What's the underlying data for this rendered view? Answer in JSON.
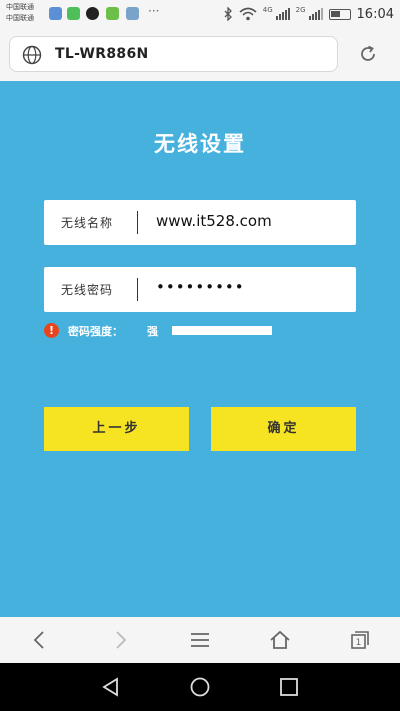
{
  "status_bar": {
    "carrier_line1": "中国联通",
    "carrier_line2": "中国联通",
    "net_4g": "4G",
    "net_2g": "2G",
    "time": "16:04"
  },
  "address_bar": {
    "url": "TL-WR886N"
  },
  "page": {
    "title": "无线设置",
    "ssid_label": "无线名称",
    "ssid_value": "www.it528.com",
    "password_label": "无线密码",
    "password_value": "•••••••••",
    "strength_label": "密码强度：",
    "strength_value": "强",
    "prev_button": "上一步",
    "ok_button": "确定"
  },
  "colors": {
    "panel_bg": "#45b1dc",
    "button_bg": "#f6e422",
    "warning": "#e8451e"
  },
  "icons": {
    "browser": [
      "globe-icon",
      "refresh-icon"
    ],
    "toolbar": [
      "back-icon",
      "forward-icon",
      "menu-icon",
      "home-icon",
      "tabs-icon"
    ],
    "nav": [
      "nav-back-icon",
      "nav-home-icon",
      "nav-recents-icon"
    ]
  }
}
